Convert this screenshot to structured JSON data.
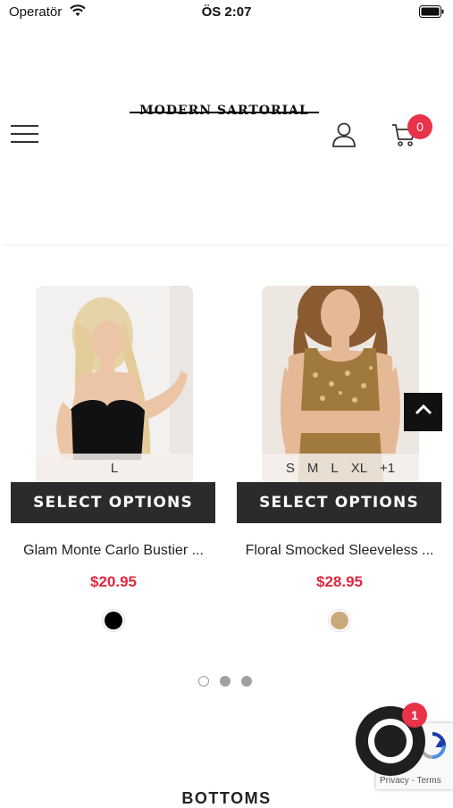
{
  "status_bar": {
    "carrier": "Operatör",
    "time": "ÖS 2:07"
  },
  "header": {
    "logo_text": "MODERN SARTORIAL",
    "cart_count": "0"
  },
  "products": [
    {
      "sizes": [
        "L"
      ],
      "button_label": "SELECT OPTIONS",
      "name": "Glam Monte Carlo Bustier ...",
      "price": "$20.95",
      "swatch_color": "#000000"
    },
    {
      "sizes": [
        "S",
        "M",
        "L",
        "XL",
        "+1"
      ],
      "button_label": "SELECT OPTIONS",
      "name": "Floral Smocked Sleeveless ...",
      "price": "$28.95",
      "swatch_color": "#c9a97c"
    }
  ],
  "carousel": {
    "active_page": 1,
    "pages": 3
  },
  "recaptcha": {
    "links": "Privacy - Terms"
  },
  "chat": {
    "badge_count": "1"
  },
  "section": {
    "title": "BOTTOMS"
  },
  "colors": {
    "accent_red": "#e0283f",
    "button_dark": "#2b2b2b"
  }
}
